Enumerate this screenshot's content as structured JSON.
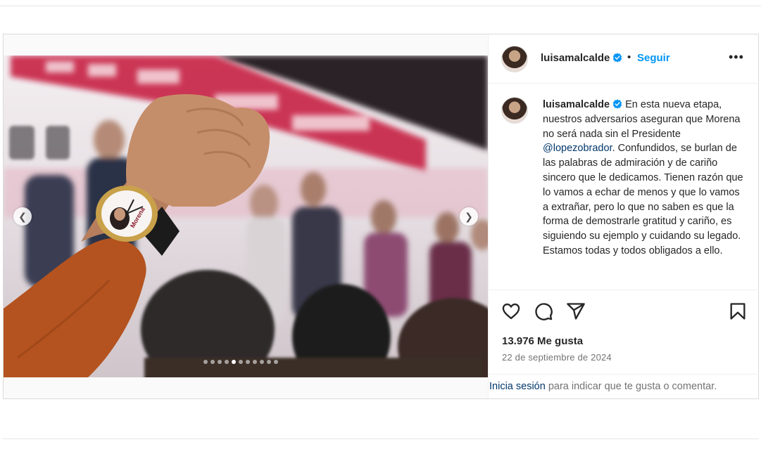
{
  "post": {
    "username": "luisamalcalde",
    "separator": "•",
    "follow_label": "Seguir",
    "more_label": "•••",
    "caption_user": "luisamalcalde",
    "caption_part1": " En esta nueva etapa, nuestros adversarios aseguran que Morena no será nada sin el Presidente ",
    "caption_mention": "@lopezobrador",
    "caption_part2": ". Confundidos, se burlan de las palabras de admiración y de cariño sincero que le dedicamos. Tienen razón que lo vamos a echar de menos y que lo vamos a extrañar, pero lo que no saben es que la forma de demostrarle gratitud y cariño, es siguiendo su ejemplo y cuidando su legado. Estamos todas y todos obligados a ello.",
    "likes": "13.976 Me gusta",
    "date": "22 de septiembre de 2024",
    "login_link": "Inicia sesión",
    "login_rest": " para indicar que te gusta o comentar.",
    "carousel": {
      "total": 11,
      "active": 5
    }
  },
  "media": {
    "watch_text": "Morena"
  },
  "icons": {
    "verified": "verified-badge-icon",
    "like": "heart-icon",
    "comment": "comment-bubble-icon",
    "share": "paper-plane-icon",
    "save": "bookmark-icon",
    "prev": "chevron-left-icon",
    "next": "chevron-right-icon"
  },
  "colors": {
    "accent_blue": "#0095f6",
    "link_dark_blue": "#00376b",
    "muted": "#737373",
    "sleeve_orange": "#b4531f",
    "banner_red": "#c5163a"
  }
}
